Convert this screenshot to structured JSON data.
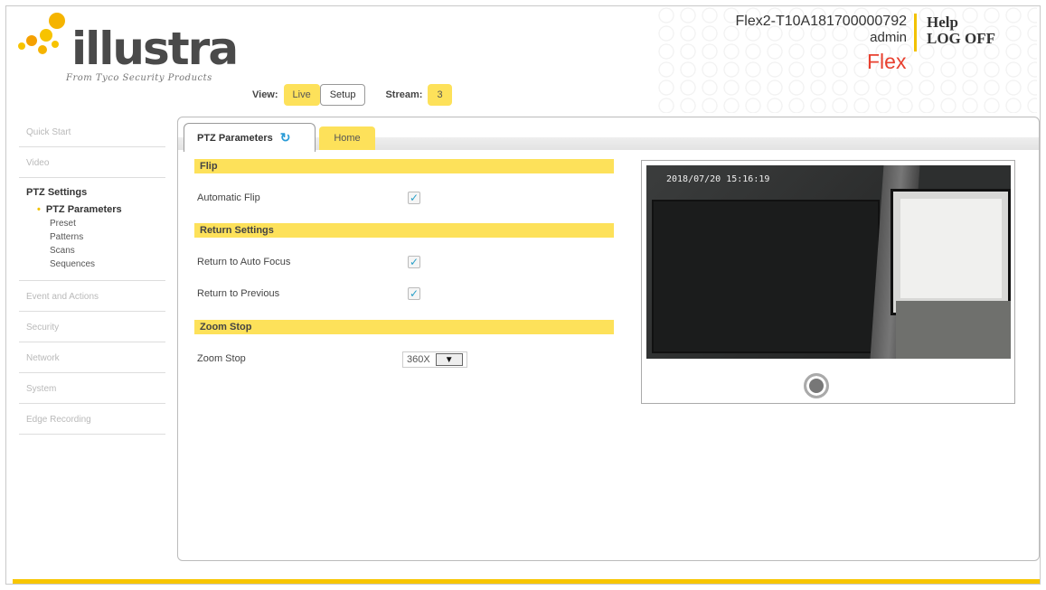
{
  "brand": {
    "name": "illustra",
    "tagline": "From Tyco Security Products"
  },
  "header": {
    "device_name": "Flex2-T10A181700000792",
    "user": "admin",
    "help": "Help",
    "logoff": "LOG OFF",
    "product": "Flex",
    "view_label": "View:",
    "live": "Live",
    "setup": "Setup",
    "stream_label": "Stream:",
    "stream_value": "3"
  },
  "sidebar": {
    "quick_start": "Quick Start",
    "video": "Video",
    "ptz_settings": "PTZ Settings",
    "ptz_items": [
      "PTZ Parameters",
      "Preset",
      "Patterns",
      "Scans",
      "Sequences"
    ],
    "event_actions": "Event and Actions",
    "security": "Security",
    "network": "Network",
    "system": "System",
    "edge_recording": "Edge Recording"
  },
  "tabs": {
    "ptz_parameters": "PTZ Parameters",
    "home": "Home"
  },
  "sections": {
    "flip": {
      "title": "Flip",
      "automatic_flip": "Automatic Flip",
      "automatic_flip_checked": true
    },
    "return": {
      "title": "Return Settings",
      "auto_focus": "Return to Auto Focus",
      "auto_focus_checked": true,
      "previous": "Return to Previous",
      "previous_checked": true
    },
    "zoom": {
      "title": "Zoom Stop",
      "label": "Zoom Stop",
      "value": "360X"
    }
  },
  "video": {
    "timestamp": "2018/07/20 15:16:19"
  },
  "colors": {
    "accent_yellow": "#fde15a",
    "brand_orange": "#f7c600",
    "flex_red": "#e8402f"
  }
}
